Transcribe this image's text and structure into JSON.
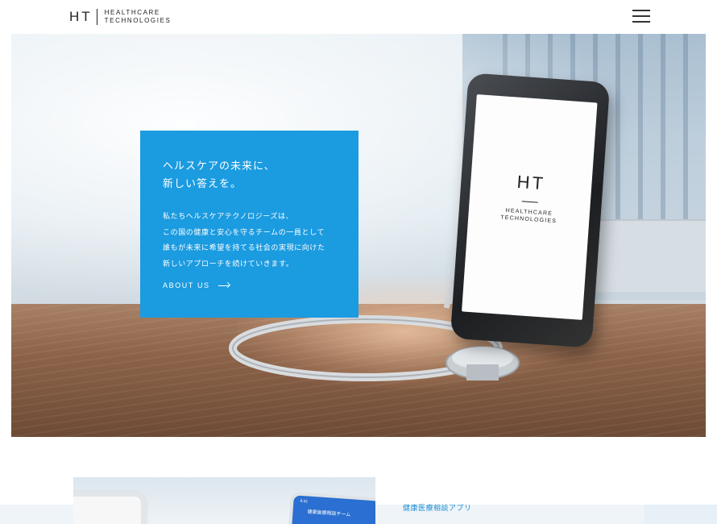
{
  "header": {
    "logo_mark": "HT",
    "logo_line1": "HEALTHCARE",
    "logo_line2": "TECHNOLOGIES",
    "menu_icon": "hamburger-menu-icon"
  },
  "hero": {
    "phone_mark": "HT",
    "phone_line1": "HEALTHCARE",
    "phone_line2": "TECHNOLOGIES",
    "panel": {
      "heading_line1": "ヘルスケアの未来に、",
      "heading_line2": "新しい答えを。",
      "body_lines": [
        "私たちヘルスケアテクノロジーズは、",
        "この国の健康と安心を守るチームの一員として",
        "誰もが未来に希望を持てる社会の実現に向けた",
        "新しいアプローチを続けていきます。"
      ],
      "link_label": "ABOUT US",
      "link_icon": "arrow-right-icon",
      "color": "#1b9be0"
    }
  },
  "section": {
    "app_label": "健康医療相談アプリ",
    "phone_status": "9:41",
    "phone_title": "健康医療相談チーム",
    "accent": "#1b8fd6"
  }
}
